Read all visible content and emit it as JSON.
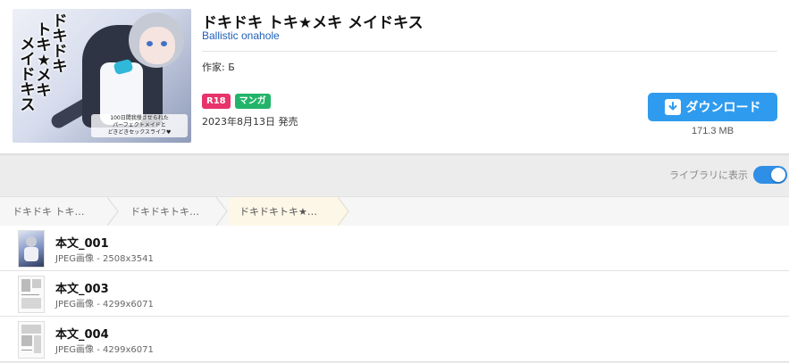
{
  "book": {
    "title": "ドキドキ トキ★メキ メイドキス",
    "circle": "Ballistic onahole",
    "author_label": "作家: ",
    "author_name": "Б",
    "tags": [
      {
        "label": "R18",
        "color": "#e8336b"
      },
      {
        "label": "マンガ",
        "color": "#22b46a"
      }
    ],
    "release": "2023年8月13日 発売",
    "cover": {
      "title_columns": [
        "ドキドキ",
        "トキ★メキ",
        "メイドキス"
      ],
      "caption": "100日間我慢させられた\nパーフェクトメイドと\nどきどきセックスライフ♥"
    }
  },
  "download": {
    "label": "ダウンロード",
    "icon": "download-icon",
    "size": "171.3 MB"
  },
  "library": {
    "label": "ライブラリに表示",
    "enabled": true
  },
  "breadcrumbs": [
    "ドキドキ トキ…",
    "ドキドキトキ…",
    "ドキドキトキ★…"
  ],
  "files": [
    {
      "name": "本文_001",
      "meta": "JPEG画像 - 2508x3541"
    },
    {
      "name": "本文_003",
      "meta": "JPEG画像 - 4299x6071"
    },
    {
      "name": "本文_004",
      "meta": "JPEG画像 - 4299x6071"
    }
  ],
  "colors": {
    "accent": "#2f9bef",
    "toggle": "#2f8fe6",
    "circle_link": "#1f5fb8"
  }
}
